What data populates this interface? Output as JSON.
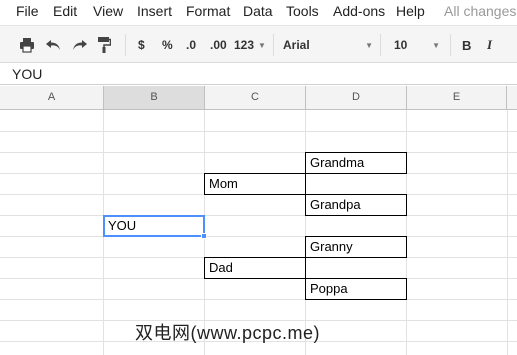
{
  "menu": {
    "items": [
      "File",
      "Edit",
      "View",
      "Insert",
      "Format",
      "Data",
      "Tools",
      "Add-ons",
      "Help"
    ],
    "status": "All changes"
  },
  "toolbar": {
    "print_icon": "printer-icon",
    "undo_icon": "undo-icon",
    "redo_icon": "redo-icon",
    "paint_format_icon": "paint-format-icon",
    "currency_label": "$",
    "percent_label": "%",
    "decrease_decimal_label": ".0",
    "increase_decimal_label": ".00",
    "more_formats_label": "123",
    "font_family": "Arial",
    "font_size": "10",
    "bold_label": "B",
    "italic_label": "I"
  },
  "formula_bar": {
    "value": "YOU"
  },
  "columns": [
    "A",
    "B",
    "C",
    "D",
    "E"
  ],
  "active_column": "B",
  "cells": {
    "grandma": "Grandma",
    "mom": "Mom",
    "grandpa": "Grandpa",
    "you": "YOU",
    "granny": "Granny",
    "dad": "Dad",
    "poppa": "Poppa"
  },
  "colors": {
    "selection": "#4d90fe",
    "toolbar_bg": "#f5f5f5",
    "header_bg": "#f3f3f3",
    "active_header_bg": "#dddddd"
  },
  "watermark": "双电网(www.pcpc.me)"
}
